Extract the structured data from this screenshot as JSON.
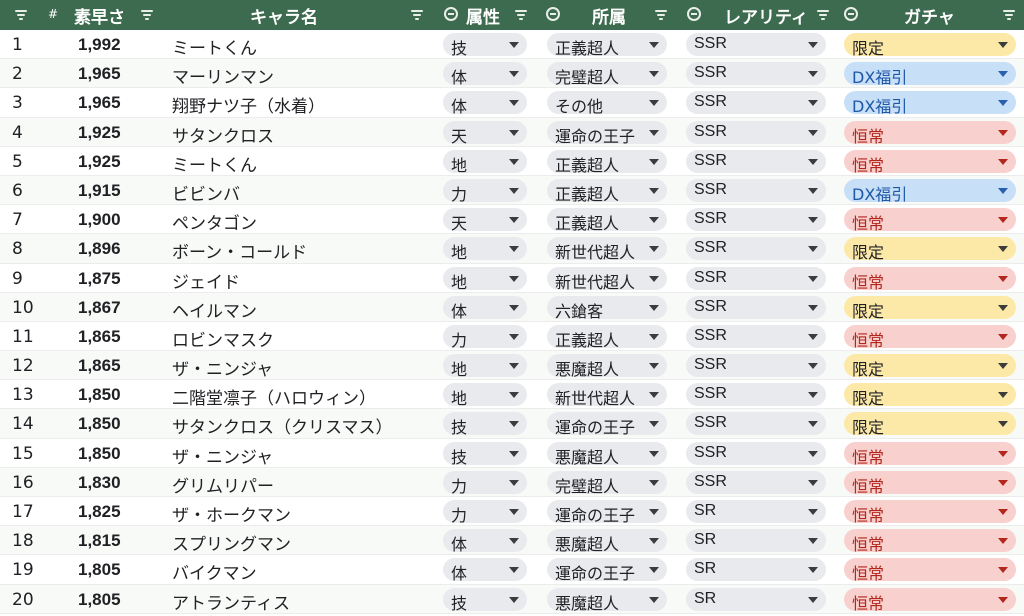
{
  "header": {
    "num": "#",
    "speed": "素早さ",
    "name": "キャラ名",
    "attr": "属性",
    "affiliation": "所属",
    "rarity": "レアリティ",
    "gacha": "ガチャ"
  },
  "colors": {
    "header_bg": "#3d6b4f",
    "limited": "#fde9a7",
    "dx": "#c7dff7",
    "normal": "#f8d0cd"
  },
  "rows": [
    {
      "num": "1",
      "speed": "1,992",
      "name": "ミートくん",
      "attr": "技",
      "aff": "正義超人",
      "rarity": "SSR",
      "gacha": "限定",
      "gtype": "limited"
    },
    {
      "num": "2",
      "speed": "1,965",
      "name": "マーリンマン",
      "attr": "体",
      "aff": "完璧超人",
      "rarity": "SSR",
      "gacha": "DX福引",
      "gtype": "dx"
    },
    {
      "num": "3",
      "speed": "1,965",
      "name": "翔野ナツ子（水着）",
      "attr": "体",
      "aff": "その他",
      "rarity": "SSR",
      "gacha": "DX福引",
      "gtype": "dx"
    },
    {
      "num": "4",
      "speed": "1,925",
      "name": "サタンクロス",
      "attr": "天",
      "aff": "運命の王子",
      "rarity": "SSR",
      "gacha": "恒常",
      "gtype": "normal"
    },
    {
      "num": "5",
      "speed": "1,925",
      "name": "ミートくん",
      "attr": "地",
      "aff": "正義超人",
      "rarity": "SSR",
      "gacha": "恒常",
      "gtype": "normal"
    },
    {
      "num": "6",
      "speed": "1,915",
      "name": "ビビンバ",
      "attr": "力",
      "aff": "正義超人",
      "rarity": "SSR",
      "gacha": "DX福引",
      "gtype": "dx"
    },
    {
      "num": "7",
      "speed": "1,900",
      "name": "ペンタゴン",
      "attr": "天",
      "aff": "正義超人",
      "rarity": "SSR",
      "gacha": "恒常",
      "gtype": "normal"
    },
    {
      "num": "8",
      "speed": "1,896",
      "name": "ボーン・コールド",
      "attr": "地",
      "aff": "新世代超人",
      "rarity": "SSR",
      "gacha": "限定",
      "gtype": "limited"
    },
    {
      "num": "9",
      "speed": "1,875",
      "name": "ジェイド",
      "attr": "地",
      "aff": "新世代超人",
      "rarity": "SSR",
      "gacha": "恒常",
      "gtype": "normal"
    },
    {
      "num": "10",
      "speed": "1,867",
      "name": "ヘイルマン",
      "attr": "体",
      "aff": "六鎗客",
      "rarity": "SSR",
      "gacha": "限定",
      "gtype": "limited"
    },
    {
      "num": "11",
      "speed": "1,865",
      "name": "ロビンマスク",
      "attr": "力",
      "aff": "正義超人",
      "rarity": "SSR",
      "gacha": "恒常",
      "gtype": "normal"
    },
    {
      "num": "12",
      "speed": "1,865",
      "name": "ザ・ニンジャ",
      "attr": "地",
      "aff": "悪魔超人",
      "rarity": "SSR",
      "gacha": "限定",
      "gtype": "limited"
    },
    {
      "num": "13",
      "speed": "1,850",
      "name": "二階堂凛子（ハロウィン）",
      "attr": "地",
      "aff": "新世代超人",
      "rarity": "SSR",
      "gacha": "限定",
      "gtype": "limited"
    },
    {
      "num": "14",
      "speed": "1,850",
      "name": "サタンクロス（クリスマス）",
      "attr": "技",
      "aff": "運命の王子",
      "rarity": "SSR",
      "gacha": "限定",
      "gtype": "limited"
    },
    {
      "num": "15",
      "speed": "1,850",
      "name": "ザ・ニンジャ",
      "attr": "技",
      "aff": "悪魔超人",
      "rarity": "SSR",
      "gacha": "恒常",
      "gtype": "normal"
    },
    {
      "num": "16",
      "speed": "1,830",
      "name": "グリムリパー",
      "attr": "力",
      "aff": "完璧超人",
      "rarity": "SSR",
      "gacha": "恒常",
      "gtype": "normal"
    },
    {
      "num": "17",
      "speed": "1,825",
      "name": "ザ・ホークマン",
      "attr": "力",
      "aff": "運命の王子",
      "rarity": "SR",
      "gacha": "恒常",
      "gtype": "normal"
    },
    {
      "num": "18",
      "speed": "1,815",
      "name": "スプリングマン",
      "attr": "体",
      "aff": "悪魔超人",
      "rarity": "SR",
      "gacha": "恒常",
      "gtype": "normal"
    },
    {
      "num": "19",
      "speed": "1,805",
      "name": "バイクマン",
      "attr": "体",
      "aff": "運命の王子",
      "rarity": "SR",
      "gacha": "恒常",
      "gtype": "normal"
    },
    {
      "num": "20",
      "speed": "1,805",
      "name": "アトランティス",
      "attr": "技",
      "aff": "悪魔超人",
      "rarity": "SR",
      "gacha": "恒常",
      "gtype": "normal"
    }
  ]
}
